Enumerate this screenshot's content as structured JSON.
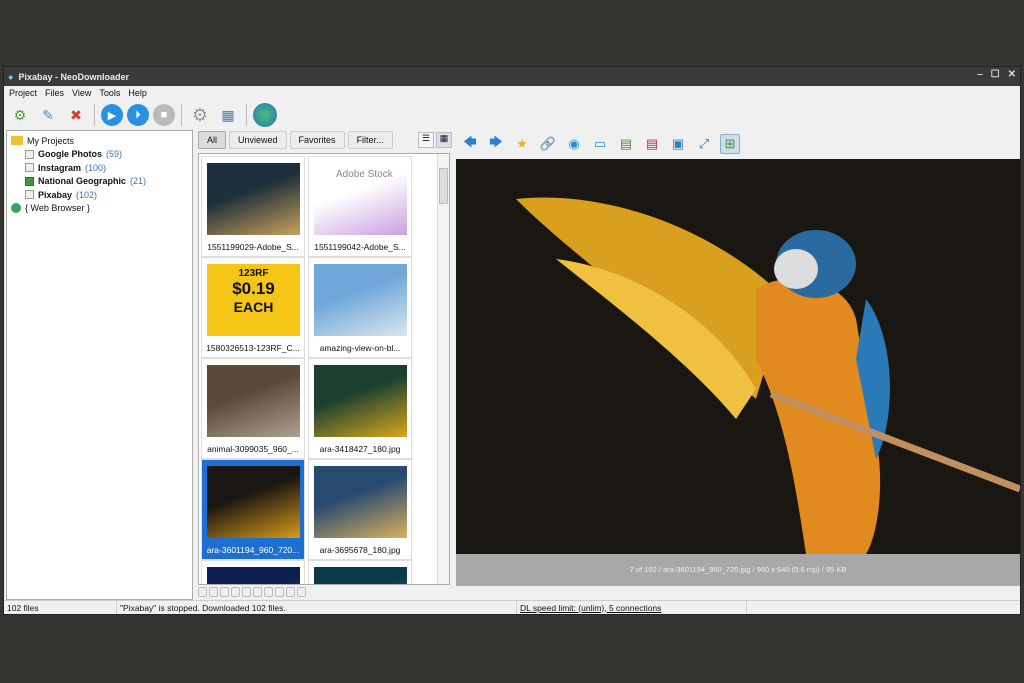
{
  "window": {
    "title": "Pixabay - NeoDownloader"
  },
  "menu": [
    "Project",
    "Files",
    "View",
    "Tools",
    "Help"
  ],
  "tree": {
    "root": "My Projects",
    "projects": [
      {
        "name": "Google Photos",
        "count": "(59)",
        "checked": false
      },
      {
        "name": "Instagram",
        "count": "(100)",
        "checked": false
      },
      {
        "name": "National Geographic",
        "count": "(21)",
        "checked": true
      },
      {
        "name": "Pixabay",
        "count": "(102)",
        "checked": false
      }
    ],
    "browser": "{ Web Browser }"
  },
  "tabs": [
    "All",
    "Unviewed",
    "Favorites",
    "Filter..."
  ],
  "thumbnails": [
    {
      "caption": "1551199029-Adobe_S...",
      "colors": [
        "#1d2f3a",
        "#c9a15a"
      ]
    },
    {
      "caption": "1551199042-Adobe_S...",
      "colors": [
        "#ffffff",
        "#c9a0e0"
      ]
    },
    {
      "caption": "1580326513-123RF_C...",
      "colors": [
        "#f5c518",
        "#f5c518"
      ]
    },
    {
      "caption": "amazing-view-on-bl...",
      "colors": [
        "#6fa7d8",
        "#d9e6f0"
      ]
    },
    {
      "caption": "animal-3099035_960_...",
      "colors": [
        "#5a4a3a",
        "#b0a090"
      ]
    },
    {
      "caption": "ara-3418427_180.jpg",
      "colors": [
        "#1b4030",
        "#d9a81a"
      ]
    },
    {
      "caption": "ara-3601194_960_720...",
      "colors": [
        "#1a1612",
        "#d99a1a"
      ],
      "selected": true
    },
    {
      "caption": "ara-3695678_180.jpg",
      "colors": [
        "#284a70",
        "#d9b060"
      ]
    },
    {
      "caption": "",
      "colors": [
        "#0c1e50",
        "#3a6ab0"
      ]
    },
    {
      "caption": "",
      "colors": [
        "#0b3a4a",
        "#2aa0b0"
      ]
    }
  ],
  "thumb_ads": {
    "stock": "Adobe Stock",
    "rf_logo": "123RF",
    "rf_price": "$0.19",
    "rf_each": "EACH"
  },
  "viewer": {
    "caption": "7 of 102 / ara-3601194_960_720.jpg / 960 x 640 (0.6 mp) / 95 KB"
  },
  "status": {
    "files": "102 files",
    "message": "\"Pixabay\" is stopped. Downloaded 102 files.",
    "speed": "DL speed limit: (unlim), 5 connections"
  }
}
